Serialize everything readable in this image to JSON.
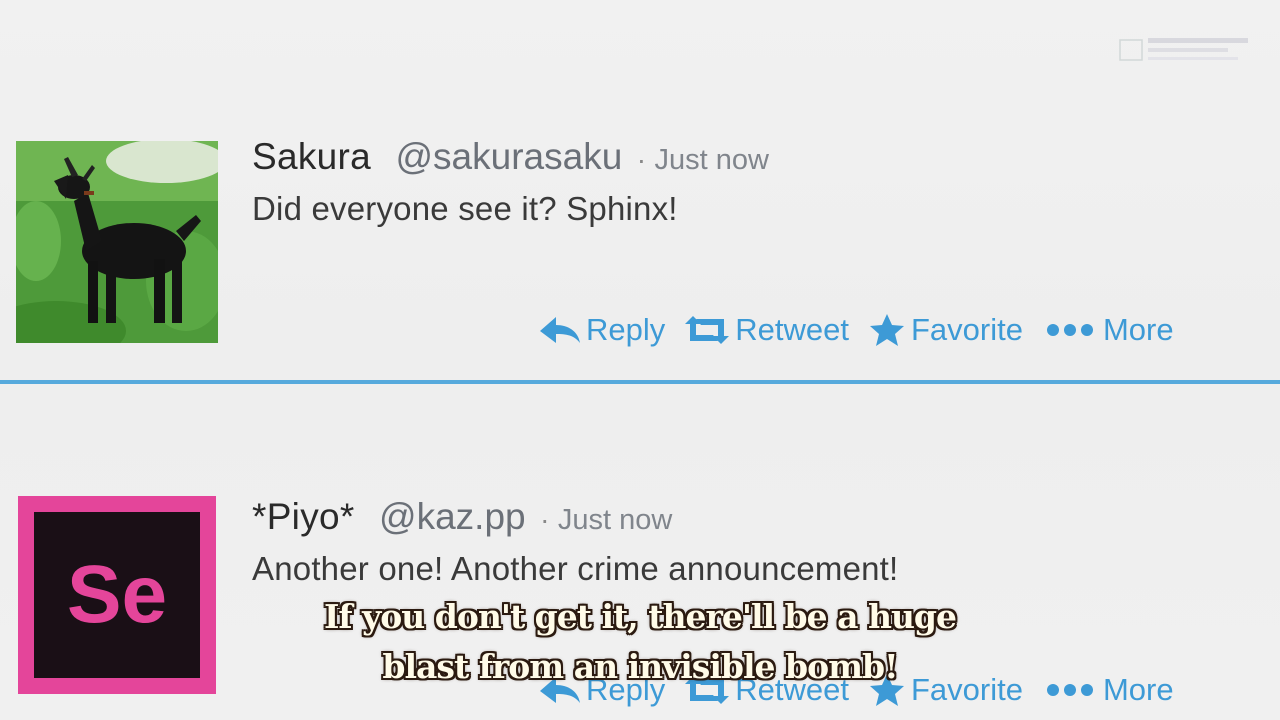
{
  "tweets": [
    {
      "display_name": "Sakura",
      "handle": "@sakurasaku",
      "separator": "·",
      "time": "Just now",
      "text": "Did everyone see it? Sphinx!",
      "avatar": "goat-photo"
    },
    {
      "display_name": "*Piyo*",
      "handle": "@kaz.pp",
      "separator": "·",
      "time": "Just now",
      "text": "Another one! Another crime announcement!",
      "avatar": "se-logo",
      "avatar_text": "Se"
    }
  ],
  "actions": {
    "reply": "Reply",
    "retweet": "Retweet",
    "favorite": "Favorite",
    "more": "More"
  },
  "subtitles": {
    "line1": "If you don't get it, there'll be a huge",
    "line2": "blast from an invisible bomb!"
  },
  "colors": {
    "accent": "#3d9ad6",
    "divider": "#56a9dc",
    "se_logo_border": "#e4459a",
    "se_logo_bg": "#1a0f16"
  },
  "icons": [
    "reply-icon",
    "retweet-icon",
    "star-icon",
    "more-dots-icon"
  ]
}
